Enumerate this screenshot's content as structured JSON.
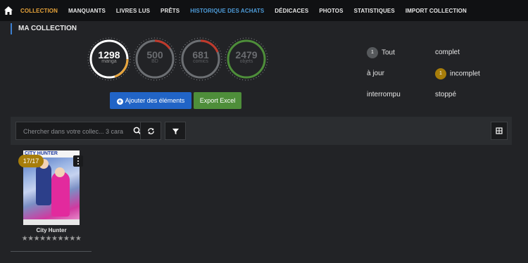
{
  "nav": {
    "items": [
      "COLLECTION",
      "MANQUANTS",
      "LIVRES LUS",
      "PRÊTS",
      "HISTORIQUE DES ACHATS",
      "DÉDICACES",
      "PHOTOS",
      "STATISTIQUES",
      "IMPORT COLLECTION"
    ],
    "active_color": "#e8a43a",
    "history_color": "#4d9bd8"
  },
  "page": {
    "title": "MA COLLECTION"
  },
  "gauges": [
    {
      "value": "1298",
      "label": "manga",
      "color": "#e8a43a"
    },
    {
      "value": "500",
      "label": "BD",
      "color": "#c0392b"
    },
    {
      "value": "681",
      "label": "comics",
      "color": "#c0392b"
    },
    {
      "value": "2479",
      "label": "objets",
      "color": "#4e8e3a"
    }
  ],
  "buttons": {
    "add": "Ajouter des éléments",
    "export": "Export Excel"
  },
  "filters": {
    "all": {
      "count": "1",
      "label": "Tout"
    },
    "complete": "complet",
    "uptodate": "à jour",
    "incomplete": {
      "count": "1",
      "label": "incomplet"
    },
    "interrupted": "interrompu",
    "stopped": "stoppé"
  },
  "search": {
    "placeholder": "Chercher dans votre collec... 3 cara"
  },
  "card": {
    "badge": "17/17",
    "cover_text": "CITY HUNTER",
    "title": "City Hunter",
    "stars": "★★★★★★★★★★"
  }
}
